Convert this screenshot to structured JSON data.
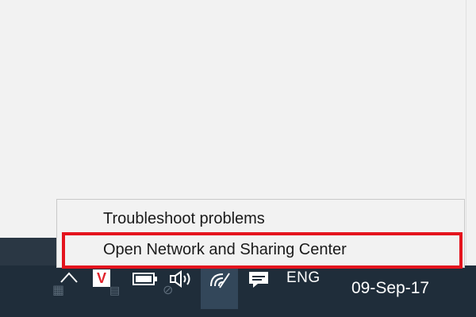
{
  "context_menu": {
    "items": [
      {
        "label": "Troubleshoot problems"
      },
      {
        "label": "Open Network and Sharing Center"
      }
    ]
  },
  "taskbar": {
    "language": "ENG",
    "date": "09-Sep-17",
    "tray_icons": [
      "chevron-up-icon",
      "v-app-icon",
      "battery-icon",
      "speaker-icon",
      "wifi-icon",
      "notification-icon"
    ]
  },
  "colors": {
    "taskbar_background": "#1f2d3a",
    "menu_background": "#f2f2f2",
    "highlight_border": "#e4141e",
    "v_icon_red": "#e0222b"
  }
}
